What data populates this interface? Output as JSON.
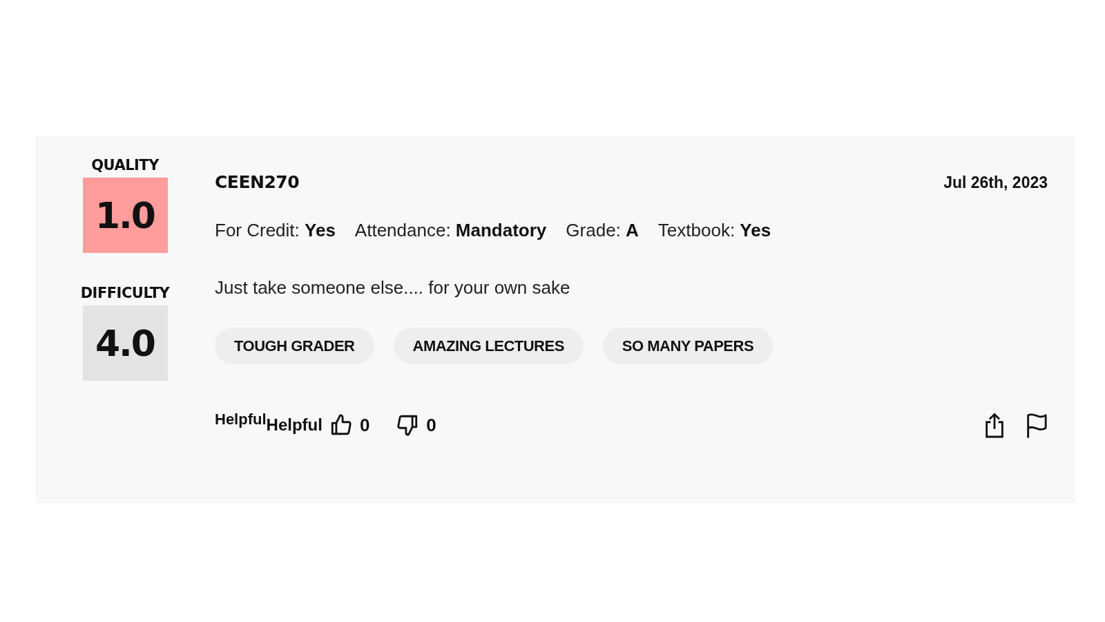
{
  "ratings": [
    {
      "label": "QUALITY",
      "value": "1.0",
      "color": "#ff9c9c"
    },
    {
      "label": "DIFFICULTY",
      "value": "4.0",
      "color": "#e4e4e4"
    }
  ],
  "course": "CEEN270",
  "date": "Jul 26th, 2023",
  "meta": [
    {
      "label": "For Credit:",
      "value": "Yes"
    },
    {
      "label": "Attendance:",
      "value": "Mandatory"
    },
    {
      "label": "Grade:",
      "value": "A"
    },
    {
      "label": "Textbook:",
      "value": "Yes"
    }
  ],
  "comment": "Just take someone else.... for your own sake",
  "tags": [
    "TOUGH GRADER",
    "AMAZING LECTURES",
    "SO MANY PAPERS"
  ],
  "footer": {
    "helpful_labels": [
      "Helpful",
      "Helpful"
    ],
    "thumbs_up_count": "0",
    "thumbs_down_count": "0"
  }
}
